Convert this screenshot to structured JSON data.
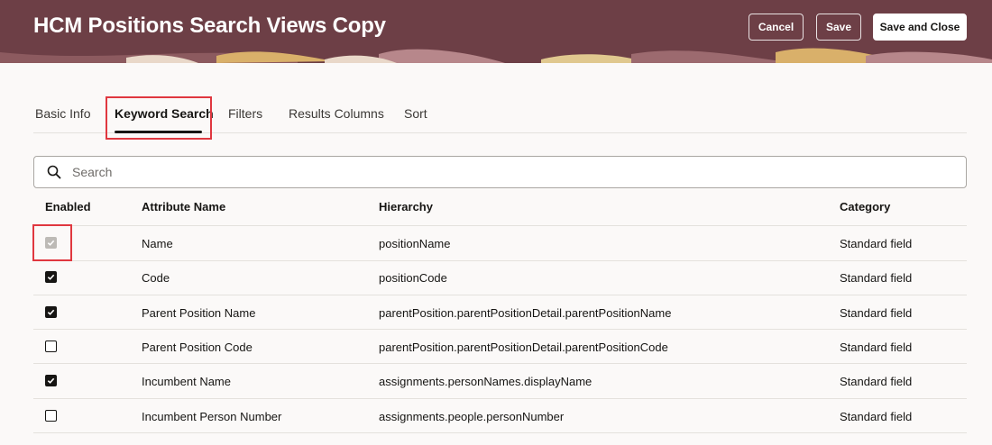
{
  "header": {
    "title": "HCM Positions Search Views Copy",
    "cancel_label": "Cancel",
    "save_label": "Save",
    "save_close_label": "Save and Close",
    "bg_color": "#6d3f46"
  },
  "tabs": [
    {
      "label": "Basic Info",
      "active": false
    },
    {
      "label": "Keyword Search",
      "active": true
    },
    {
      "label": "Filters",
      "active": false
    },
    {
      "label": "Results Columns",
      "active": false
    },
    {
      "label": "Sort",
      "active": false
    }
  ],
  "search": {
    "placeholder": "Search",
    "icon": "search-icon"
  },
  "table": {
    "columns": [
      "Enabled",
      "Attribute Name",
      "Hierarchy",
      "Category"
    ],
    "rows": [
      {
        "enabled": "checked-disabled",
        "attribute": "Name",
        "hierarchy": "positionName",
        "category": "Standard field"
      },
      {
        "enabled": "checked",
        "attribute": "Code",
        "hierarchy": "positionCode",
        "category": "Standard field"
      },
      {
        "enabled": "checked",
        "attribute": "Parent Position Name",
        "hierarchy": "parentPosition.parentPositionDetail.parentPositionName",
        "category": "Standard field"
      },
      {
        "enabled": "unchecked",
        "attribute": "Parent Position Code",
        "hierarchy": "parentPosition.parentPositionDetail.parentPositionCode",
        "category": "Standard field"
      },
      {
        "enabled": "checked",
        "attribute": "Incumbent Name",
        "hierarchy": "assignments.personNames.displayName",
        "category": "Standard field"
      },
      {
        "enabled": "unchecked",
        "attribute": "Incumbent Person Number",
        "hierarchy": "assignments.people.personNumber",
        "category": "Standard field"
      }
    ]
  },
  "colors": {
    "highlight": "#e0373f",
    "accent": "#161513"
  }
}
